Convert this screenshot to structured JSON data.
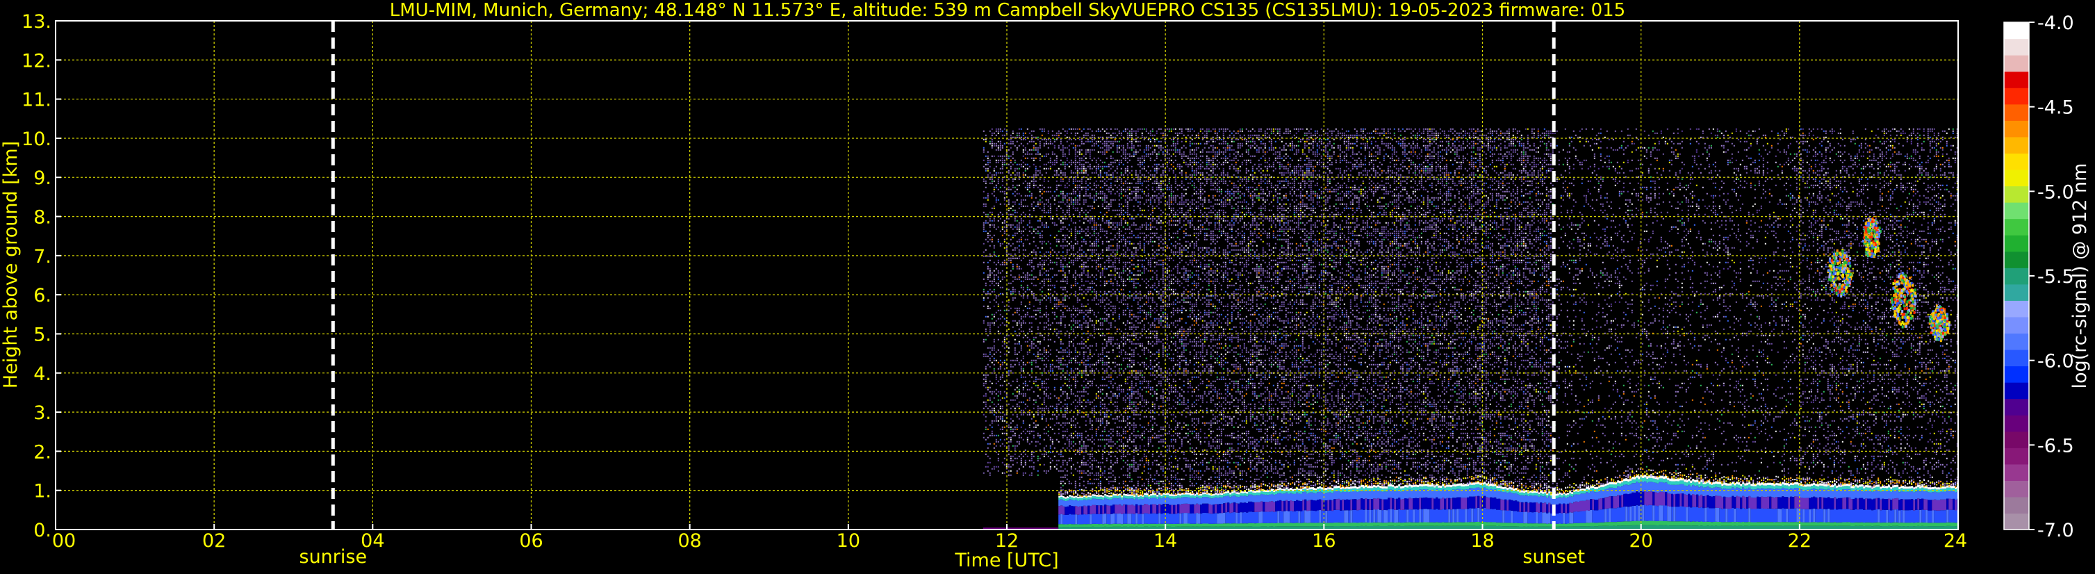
{
  "colors": {
    "background": "#000000",
    "text": "#ffff00",
    "grid": "#cccc00",
    "frame": "#ffffff",
    "event_line": "#ffffff"
  },
  "chart_data": {
    "type": "heatmap",
    "title": "LMU-MIM, Munich, Germany; 48.148° N 11.573° E, altitude: 539 m    Campbell SkyVUEPRO CS135 (CS135LMU): 19-05-2023    firmware: 015",
    "xlabel": "Time [UTC]",
    "ylabel": "Height above ground [km]",
    "xlim": [
      0,
      24
    ],
    "ylim": [
      0,
      13
    ],
    "x_ticks": [
      0,
      2,
      4,
      6,
      8,
      10,
      12,
      14,
      16,
      18,
      20,
      22,
      24
    ],
    "x_tick_labels": [
      "00",
      "02",
      "04",
      "06",
      "08",
      "10",
      "12",
      "14",
      "16",
      "18",
      "20",
      "22",
      "24"
    ],
    "y_ticks": [
      0,
      1,
      2,
      3,
      4,
      5,
      6,
      7,
      8,
      9,
      10,
      11,
      12,
      13
    ],
    "y_tick_labels": [
      "0.",
      "1.",
      "2.",
      "3.",
      "4.",
      "5.",
      "6.",
      "7.",
      "8.",
      "9.",
      "10.",
      "11.",
      "12.",
      "13."
    ],
    "grid": true,
    "events": [
      {
        "label": "sunrise",
        "x": 3.5
      },
      {
        "label": "sunset",
        "x": 18.9
      }
    ],
    "data_start_x": 11.7,
    "data_full_x": 12.65,
    "data_top_km": 10.25,
    "colorbar": {
      "label": "log(rc-signal) @ 912 nm",
      "range": [
        -7.0,
        -4.0
      ],
      "ticks": [
        -7.0,
        -6.5,
        -6.0,
        -5.5,
        -5.0,
        -4.5,
        -4.0
      ],
      "tick_labels": [
        "-7.0",
        "-6.5",
        "-6.0",
        "-5.5",
        "-5.0",
        "-4.5",
        "-4.0"
      ],
      "colors": [
        "#a890a8",
        "#9c7a9c",
        "#a0609c",
        "#983890",
        "#881878",
        "#780868",
        "#68007c",
        "#500090",
        "#0000c0",
        "#0030ff",
        "#2858ff",
        "#5078ff",
        "#7890ff",
        "#98a8ff",
        "#30a8a0",
        "#20a078",
        "#109030",
        "#20b030",
        "#40c840",
        "#70e070",
        "#b8e830",
        "#f0f000",
        "#ffe000",
        "#ffb800",
        "#ff9000",
        "#ff6000",
        "#ff2800",
        "#e00000",
        "#e8b8b8",
        "#f0e0e0",
        "#ffffff"
      ]
    },
    "boundary_layer_top_km": [
      {
        "x": 12.65,
        "y": 0.85
      },
      {
        "x": 13.5,
        "y": 0.9
      },
      {
        "x": 14.5,
        "y": 0.92
      },
      {
        "x": 15.5,
        "y": 1.05
      },
      {
        "x": 16.5,
        "y": 1.12
      },
      {
        "x": 17.5,
        "y": 1.15
      },
      {
        "x": 18.0,
        "y": 1.22
      },
      {
        "x": 18.5,
        "y": 1.0
      },
      {
        "x": 19.0,
        "y": 0.92
      },
      {
        "x": 19.5,
        "y": 1.15
      },
      {
        "x": 20.0,
        "y": 1.4
      },
      {
        "x": 20.5,
        "y": 1.3
      },
      {
        "x": 21.0,
        "y": 1.2
      },
      {
        "x": 22.0,
        "y": 1.18
      },
      {
        "x": 23.0,
        "y": 1.12
      },
      {
        "x": 24.0,
        "y": 1.1
      }
    ],
    "cloud_features": [
      {
        "x": 22.5,
        "y": 6.6,
        "x_extent": 0.45,
        "y_extent": 1.2
      },
      {
        "x": 22.9,
        "y": 7.5,
        "x_extent": 0.3,
        "y_extent": 1.0
      },
      {
        "x": 23.3,
        "y": 5.9,
        "x_extent": 0.45,
        "y_extent": 1.4
      },
      {
        "x": 23.75,
        "y": 5.3,
        "x_extent": 0.35,
        "y_extent": 0.9
      }
    ]
  }
}
